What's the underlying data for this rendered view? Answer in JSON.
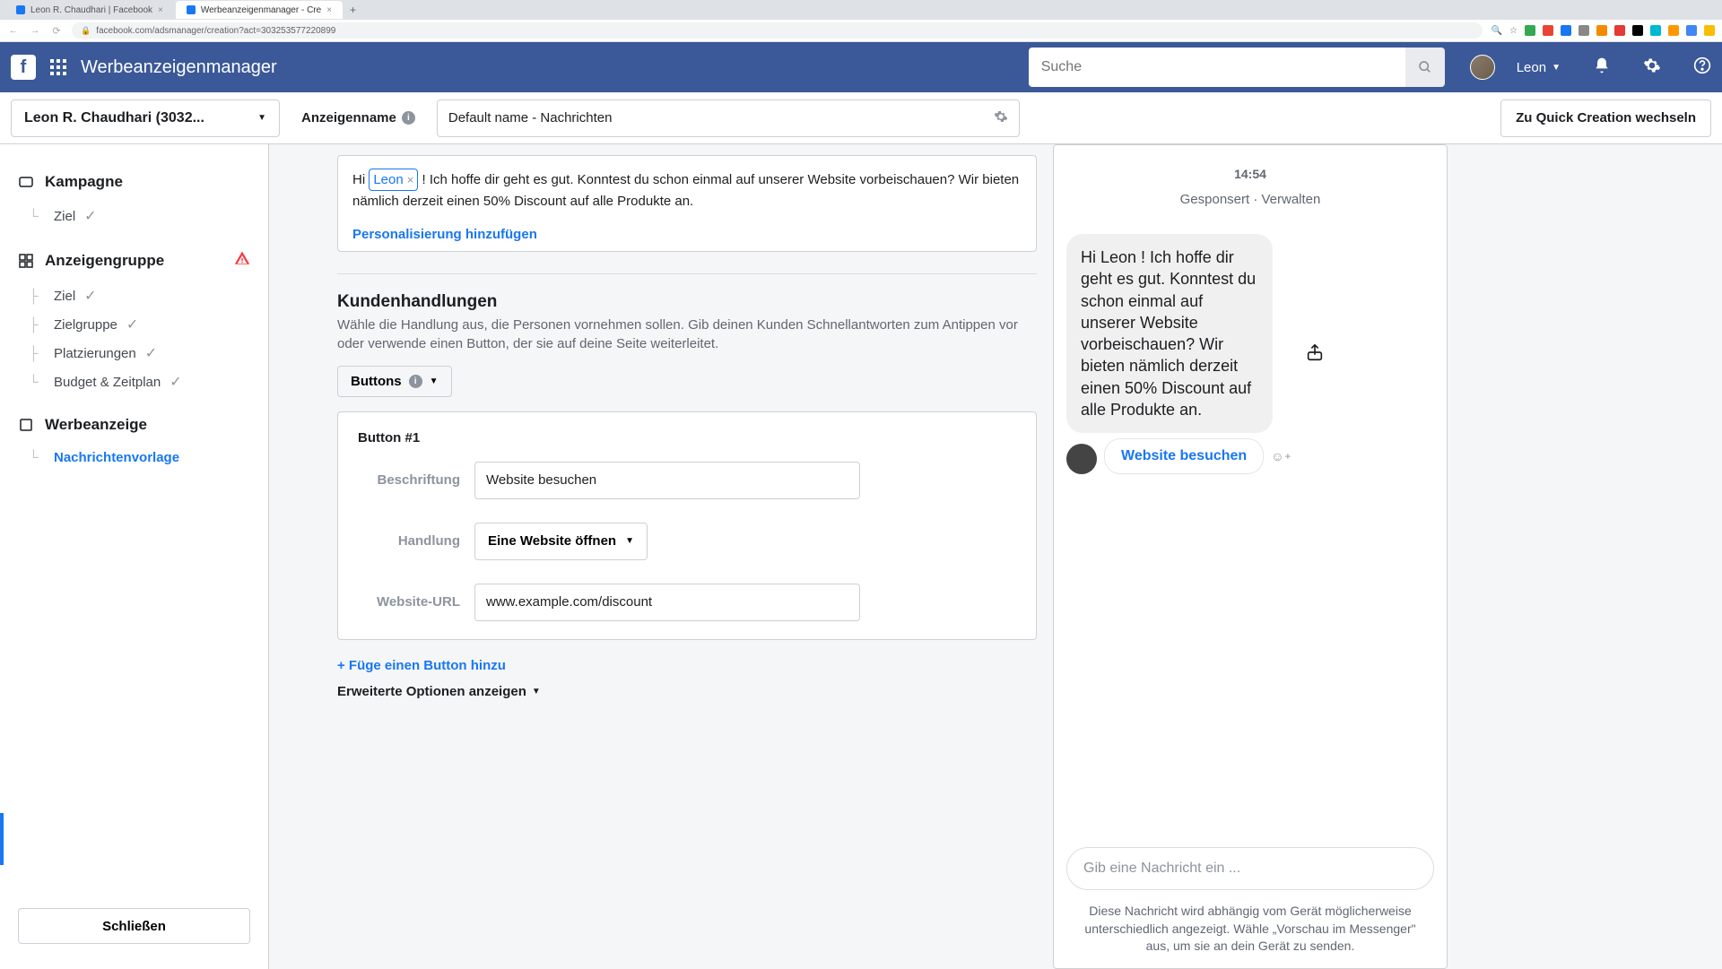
{
  "browser": {
    "tabs": [
      {
        "title": "Leon R. Chaudhari | Facebook",
        "active": false
      },
      {
        "title": "Werbeanzeigenmanager - Cre",
        "active": true
      }
    ],
    "url": "facebook.com/adsmanager/creation?act=303253577220899"
  },
  "topnav": {
    "app_title": "Werbeanzeigenmanager",
    "search_placeholder": "Suche",
    "username": "Leon"
  },
  "subheader": {
    "account": "Leon R. Chaudhari (3032...",
    "ad_name_label": "Anzeigenname",
    "ad_name_value": "Default name - Nachrichten",
    "quick_create": "Zu Quick Creation wechseln"
  },
  "sidebar": {
    "campaign": "Kampagne",
    "campaign_items": [
      {
        "label": "Ziel",
        "checked": true
      }
    ],
    "adset": "Anzeigengruppe",
    "adset_items": [
      {
        "label": "Ziel",
        "checked": true
      },
      {
        "label": "Zielgruppe",
        "checked": true
      },
      {
        "label": "Platzierungen",
        "checked": true
      },
      {
        "label": "Budget & Zeitplan",
        "checked": true
      }
    ],
    "ad": "Werbeanzeige",
    "ad_items": [
      {
        "label": "Nachrichtenvorlage",
        "current": true
      }
    ],
    "close": "Schließen"
  },
  "editor": {
    "msg_hi": "Hi",
    "msg_token": "Leon",
    "msg_rest": "! Ich hoffe dir geht es gut. Konntest du schon einmal auf unserer Website vorbeischauen? Wir bieten nämlich derzeit einen 50% Discount auf alle Produkte an.",
    "add_pers": "Personalisierung hinzufügen",
    "section_title": "Kundenhandlungen",
    "section_sub": "Wähle die Handlung aus, die Personen vornehmen sollen. Gib deinen Kunden Schnellantworten zum Antippen vor oder verwende einen Button, der sie auf deine Seite weiterleitet.",
    "buttons_label": "Buttons",
    "button1_title": "Button #1",
    "label_caption": "Beschriftung",
    "val_caption": "Website besuchen",
    "label_action": "Handlung",
    "val_action": "Eine Website öffnen",
    "label_url": "Website-URL",
    "val_url": "www.example.com/discount",
    "add_button": "+ Füge einen Button hinzu",
    "advanced": "Erweiterte Optionen anzeigen"
  },
  "preview": {
    "time": "14:54",
    "meta": "Gesponsert · Verwalten",
    "bubble": "Hi Leon ! Ich hoffe dir geht es gut. Konntest du schon einmal auf unserer Website vorbeischauen? Wir bieten nämlich derzeit einen 50% Discount auf alle Produkte an.",
    "visit": "Website besuchen",
    "input_placeholder": "Gib eine Nachricht ein ...",
    "footer": "Diese Nachricht wird abhängig vom Gerät möglicherweise unterschiedlich angezeigt. Wähle „Vorschau im Messenger\" aus, um sie an dein Gerät zu senden."
  }
}
